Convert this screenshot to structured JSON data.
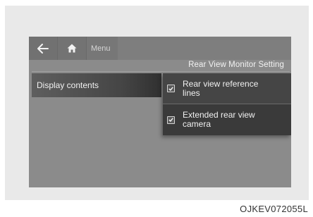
{
  "header": {
    "back_icon": "back-arrow-icon",
    "home_icon": "home-icon",
    "menu_label": "Menu"
  },
  "page": {
    "title": "Rear View Monitor Setting"
  },
  "left_menu": {
    "items": [
      {
        "label": "Display contents",
        "selected": true
      }
    ]
  },
  "options": [
    {
      "line1": "Rear view reference",
      "line2": "lines",
      "checked": true
    },
    {
      "line1": "Extended rear view",
      "line2": "camera",
      "checked": true
    }
  ],
  "caption": "OJKEV072055L"
}
